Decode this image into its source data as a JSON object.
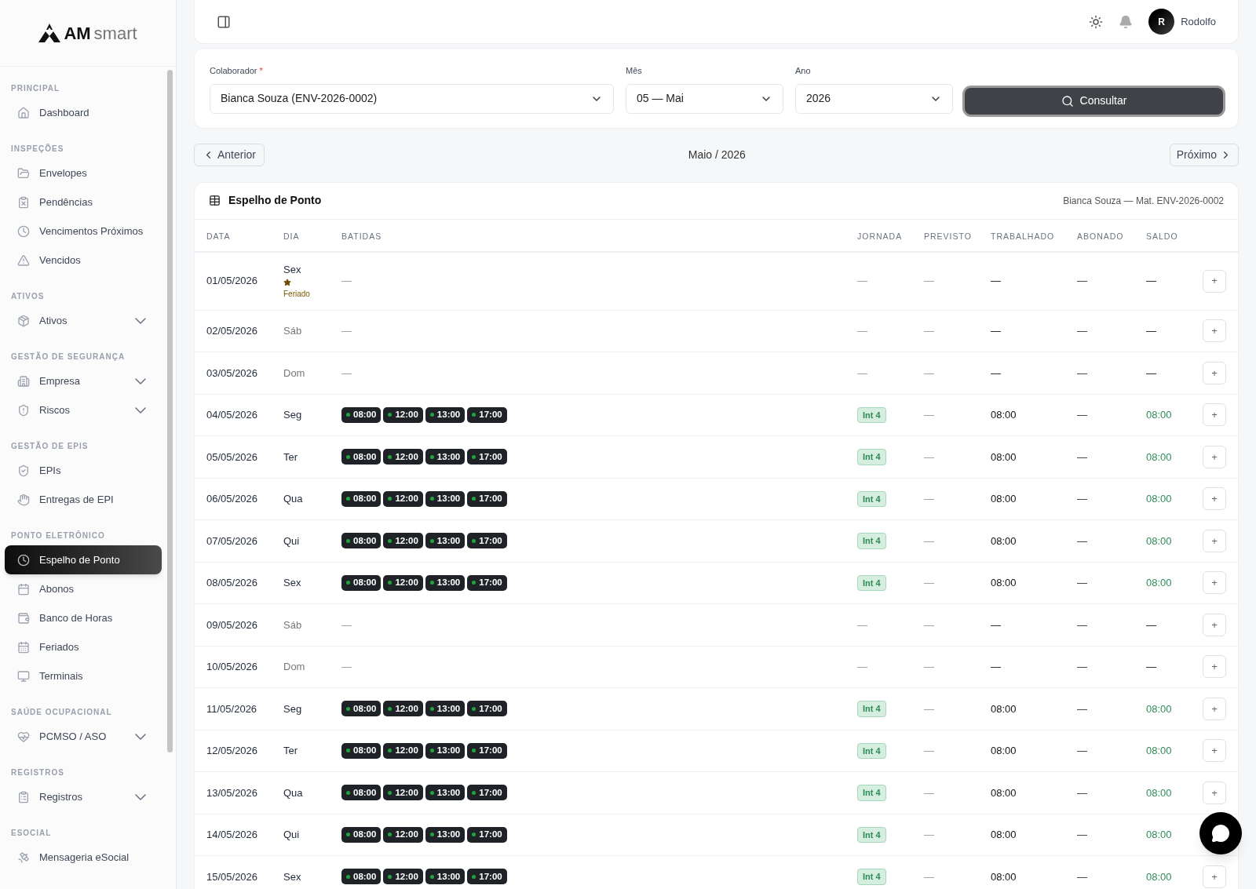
{
  "brand": {
    "name_bold": "AM",
    "name_light": "smart"
  },
  "sidebar": {
    "sections": [
      {
        "title": "PRINCIPAL",
        "items": [
          {
            "label": "Dashboard",
            "selected": false,
            "has_submenu": false
          }
        ]
      },
      {
        "title": "INSPEÇÕES",
        "items": [
          {
            "label": "Envelopes",
            "selected": false,
            "has_submenu": false
          },
          {
            "label": "Pendências",
            "selected": false,
            "has_submenu": false
          },
          {
            "label": "Vencimentos Próximos",
            "selected": false,
            "has_submenu": false
          },
          {
            "label": "Vencidos",
            "selected": false,
            "has_submenu": false
          }
        ]
      },
      {
        "title": "ATIVOS",
        "items": [
          {
            "label": "Ativos",
            "selected": false,
            "has_submenu": true
          }
        ]
      },
      {
        "title": "GESTÃO DE SEGURANÇA",
        "items": [
          {
            "label": "Empresa",
            "selected": false,
            "has_submenu": true
          },
          {
            "label": "Riscos",
            "selected": false,
            "has_submenu": true
          }
        ]
      },
      {
        "title": "GESTÃO DE EPIS",
        "items": [
          {
            "label": "EPIs",
            "selected": false,
            "has_submenu": false
          },
          {
            "label": "Entregas de EPI",
            "selected": false,
            "has_submenu": false
          }
        ]
      },
      {
        "title": "PONTO ELETRÔNICO",
        "items": [
          {
            "label": "Espelho de Ponto",
            "selected": true,
            "has_submenu": false
          },
          {
            "label": "Abonos",
            "selected": false,
            "has_submenu": false
          },
          {
            "label": "Banco de Horas",
            "selected": false,
            "has_submenu": false
          },
          {
            "label": "Feriados",
            "selected": false,
            "has_submenu": false
          },
          {
            "label": "Terminais",
            "selected": false,
            "has_submenu": false
          }
        ]
      },
      {
        "title": "SAÚDE OCUPACIONAL",
        "items": [
          {
            "label": "PCMSO / ASO",
            "selected": false,
            "has_submenu": true
          }
        ]
      },
      {
        "title": "REGISTROS",
        "items": [
          {
            "label": "Registros",
            "selected": false,
            "has_submenu": true
          }
        ]
      },
      {
        "title": "ESOCIAL",
        "items": [
          {
            "label": "Mensageria eSocial",
            "selected": false,
            "has_submenu": false
          }
        ]
      }
    ]
  },
  "header": {
    "user_initial": "R",
    "user_name": "Rodolfo"
  },
  "filters": {
    "collaborator": {
      "label": "Colaborador",
      "required_mark": "*",
      "value": "Bianca Souza (ENV-2026-0002)"
    },
    "month": {
      "label": "Mês",
      "value": "05 — Mai"
    },
    "year": {
      "label": "Ano",
      "value": "2026"
    },
    "submit": "Consultar"
  },
  "period_nav": {
    "previous": "Anterior",
    "current": "Maio / 2026",
    "next": "Próximo"
  },
  "timesheet": {
    "title": "Espelho de Ponto",
    "employee": "Bianca Souza — Mat. ENV-2026-0002",
    "columns": [
      "DATA",
      "DIA",
      "BATIDAS",
      "JORNADA",
      "PREVISTO",
      "TRABALHADO",
      "ABONADO",
      "SALDO"
    ],
    "rows": [
      {
        "kind": "off",
        "date": "01/05/2026",
        "day": "Sex",
        "weekend": false,
        "holiday": "Feriado",
        "punches": [],
        "batidas": "—",
        "jornada": "—",
        "previsto": "—",
        "trabalhado": "—",
        "abonado": "—",
        "saldo": "—",
        "action": "+"
      },
      {
        "kind": "off",
        "date": "02/05/2026",
        "day": "Sáb",
        "weekend": true,
        "punches": [],
        "batidas": "—",
        "jornada": "—",
        "previsto": "—",
        "trabalhado": "—",
        "abonado": "—",
        "saldo": "—",
        "action": "+"
      },
      {
        "kind": "off",
        "date": "03/05/2026",
        "day": "Dom",
        "weekend": true,
        "punches": [],
        "batidas": "—",
        "jornada": "—",
        "previsto": "—",
        "trabalhado": "—",
        "abonado": "—",
        "saldo": "—",
        "action": "+"
      },
      {
        "kind": "worked",
        "date": "04/05/2026",
        "day": "Seg",
        "weekend": false,
        "punches": [
          "08:00",
          "12:00",
          "13:00",
          "17:00"
        ],
        "jornada": "Int 4",
        "previsto": "—",
        "trabalhado": "08:00",
        "abonado": "—",
        "saldo": "08:00",
        "action": "+"
      },
      {
        "kind": "worked",
        "date": "05/05/2026",
        "day": "Ter",
        "weekend": false,
        "punches": [
          "08:00",
          "12:00",
          "13:00",
          "17:00"
        ],
        "jornada": "Int 4",
        "previsto": "—",
        "trabalhado": "08:00",
        "abonado": "—",
        "saldo": "08:00",
        "action": "+"
      },
      {
        "kind": "worked",
        "date": "06/05/2026",
        "day": "Qua",
        "weekend": false,
        "punches": [
          "08:00",
          "12:00",
          "13:00",
          "17:00"
        ],
        "jornada": "Int 4",
        "previsto": "—",
        "trabalhado": "08:00",
        "abonado": "—",
        "saldo": "08:00",
        "action": "+"
      },
      {
        "kind": "worked",
        "date": "07/05/2026",
        "day": "Qui",
        "weekend": false,
        "punches": [
          "08:00",
          "12:00",
          "13:00",
          "17:00"
        ],
        "jornada": "Int 4",
        "previsto": "—",
        "trabalhado": "08:00",
        "abonado": "—",
        "saldo": "08:00",
        "action": "+"
      },
      {
        "kind": "worked",
        "date": "08/05/2026",
        "day": "Sex",
        "weekend": false,
        "punches": [
          "08:00",
          "12:00",
          "13:00",
          "17:00"
        ],
        "jornada": "Int 4",
        "previsto": "—",
        "trabalhado": "08:00",
        "abonado": "—",
        "saldo": "08:00",
        "action": "+"
      },
      {
        "kind": "off",
        "date": "09/05/2026",
        "day": "Sáb",
        "weekend": true,
        "punches": [],
        "batidas": "—",
        "jornada": "—",
        "previsto": "—",
        "trabalhado": "—",
        "abonado": "—",
        "saldo": "—",
        "action": "+"
      },
      {
        "kind": "off",
        "date": "10/05/2026",
        "day": "Dom",
        "weekend": true,
        "punches": [],
        "batidas": "—",
        "jornada": "—",
        "previsto": "—",
        "trabalhado": "—",
        "abonado": "—",
        "saldo": "—",
        "action": "+"
      },
      {
        "kind": "worked",
        "date": "11/05/2026",
        "day": "Seg",
        "weekend": false,
        "punches": [
          "08:00",
          "12:00",
          "13:00",
          "17:00"
        ],
        "jornada": "Int 4",
        "previsto": "—",
        "trabalhado": "08:00",
        "abonado": "—",
        "saldo": "08:00",
        "action": "+"
      },
      {
        "kind": "worked",
        "date": "12/05/2026",
        "day": "Ter",
        "weekend": false,
        "punches": [
          "08:00",
          "12:00",
          "13:00",
          "17:00"
        ],
        "jornada": "Int 4",
        "previsto": "—",
        "trabalhado": "08:00",
        "abonado": "—",
        "saldo": "08:00",
        "action": "+"
      },
      {
        "kind": "worked",
        "date": "13/05/2026",
        "day": "Qua",
        "weekend": false,
        "punches": [
          "08:00",
          "12:00",
          "13:00",
          "17:00"
        ],
        "jornada": "Int 4",
        "previsto": "—",
        "trabalhado": "08:00",
        "abonado": "—",
        "saldo": "08:00",
        "action": "+"
      },
      {
        "kind": "worked",
        "date": "14/05/2026",
        "day": "Qui",
        "weekend": false,
        "punches": [
          "08:00",
          "12:00",
          "13:00",
          "17:00"
        ],
        "jornada": "Int 4",
        "previsto": "—",
        "trabalhado": "08:00",
        "abonado": "—",
        "saldo": "08:00"
      },
      {
        "kind": "worked",
        "date": "15/05/2026",
        "day": "Sex",
        "weekend": false,
        "punches": [
          "08:00",
          "12:00",
          "13:00",
          "17:00"
        ],
        "jornada": "Int 4",
        "previsto": "—",
        "trabalhado": "08:00",
        "abonado": "—",
        "saldo": "08:00",
        "action": "+"
      }
    ]
  }
}
